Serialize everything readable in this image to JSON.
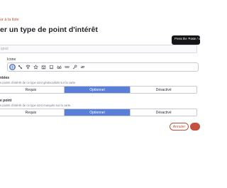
{
  "back_link": "ur à la liste",
  "title": "er un type de point d'intérêt",
  "tooltip": "Press the 'Paste / ou drop the",
  "name_input": {
    "placeholder": "ignol"
  },
  "icon_section": {
    "label": "Icone",
    "icons": [
      "globe-icon",
      "pencil-ruler-icon",
      "trophy-icon",
      "star-icon",
      "castle-icon",
      "book-icon",
      "binoculars-icon",
      "mask-icon",
      "key-icon",
      "link-icon"
    ],
    "selected_index": 0
  },
  "sections": [
    {
      "title": "ntées",
      "description": "s points d'intérêt de ce type sont géolocalisés sur la carte.",
      "options": [
        "Requis",
        "Optionnel",
        "Désactivé"
      ],
      "selected": "Optionnel"
    },
    {
      "title": "e point",
      "description": "s points d'intérêt de ce type sont marqués sur la carte.",
      "options": [
        "Requis",
        "Optionnel",
        "Désactivé"
      ],
      "selected": "Optionnel"
    }
  ],
  "actions": {
    "cancel": "Annuler"
  },
  "colors": {
    "accent": "#5a7fd8",
    "danger": "#c4503e"
  }
}
